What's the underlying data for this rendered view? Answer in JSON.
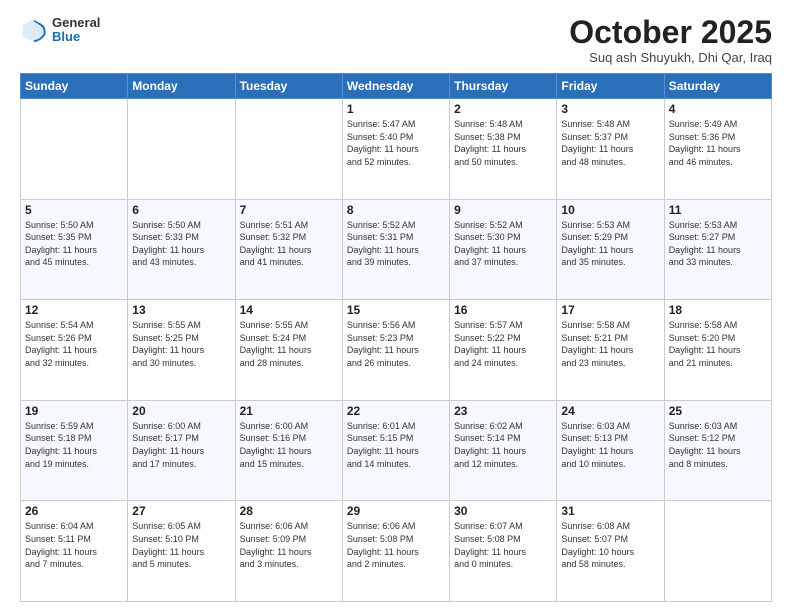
{
  "header": {
    "logo_general": "General",
    "logo_blue": "Blue",
    "month_title": "October 2025",
    "subtitle": "Suq ash Shuyukh, Dhi Qar, Iraq"
  },
  "days": [
    "Sunday",
    "Monday",
    "Tuesday",
    "Wednesday",
    "Thursday",
    "Friday",
    "Saturday"
  ],
  "weeks": [
    [
      {
        "date": "",
        "info": ""
      },
      {
        "date": "",
        "info": ""
      },
      {
        "date": "",
        "info": ""
      },
      {
        "date": "1",
        "info": "Sunrise: 5:47 AM\nSunset: 5:40 PM\nDaylight: 11 hours\nand 52 minutes."
      },
      {
        "date": "2",
        "info": "Sunrise: 5:48 AM\nSunset: 5:38 PM\nDaylight: 11 hours\nand 50 minutes."
      },
      {
        "date": "3",
        "info": "Sunrise: 5:48 AM\nSunset: 5:37 PM\nDaylight: 11 hours\nand 48 minutes."
      },
      {
        "date": "4",
        "info": "Sunrise: 5:49 AM\nSunset: 5:36 PM\nDaylight: 11 hours\nand 46 minutes."
      }
    ],
    [
      {
        "date": "5",
        "info": "Sunrise: 5:50 AM\nSunset: 5:35 PM\nDaylight: 11 hours\nand 45 minutes."
      },
      {
        "date": "6",
        "info": "Sunrise: 5:50 AM\nSunset: 5:33 PM\nDaylight: 11 hours\nand 43 minutes."
      },
      {
        "date": "7",
        "info": "Sunrise: 5:51 AM\nSunset: 5:32 PM\nDaylight: 11 hours\nand 41 minutes."
      },
      {
        "date": "8",
        "info": "Sunrise: 5:52 AM\nSunset: 5:31 PM\nDaylight: 11 hours\nand 39 minutes."
      },
      {
        "date": "9",
        "info": "Sunrise: 5:52 AM\nSunset: 5:30 PM\nDaylight: 11 hours\nand 37 minutes."
      },
      {
        "date": "10",
        "info": "Sunrise: 5:53 AM\nSunset: 5:29 PM\nDaylight: 11 hours\nand 35 minutes."
      },
      {
        "date": "11",
        "info": "Sunrise: 5:53 AM\nSunset: 5:27 PM\nDaylight: 11 hours\nand 33 minutes."
      }
    ],
    [
      {
        "date": "12",
        "info": "Sunrise: 5:54 AM\nSunset: 5:26 PM\nDaylight: 11 hours\nand 32 minutes."
      },
      {
        "date": "13",
        "info": "Sunrise: 5:55 AM\nSunset: 5:25 PM\nDaylight: 11 hours\nand 30 minutes."
      },
      {
        "date": "14",
        "info": "Sunrise: 5:55 AM\nSunset: 5:24 PM\nDaylight: 11 hours\nand 28 minutes."
      },
      {
        "date": "15",
        "info": "Sunrise: 5:56 AM\nSunset: 5:23 PM\nDaylight: 11 hours\nand 26 minutes."
      },
      {
        "date": "16",
        "info": "Sunrise: 5:57 AM\nSunset: 5:22 PM\nDaylight: 11 hours\nand 24 minutes."
      },
      {
        "date": "17",
        "info": "Sunrise: 5:58 AM\nSunset: 5:21 PM\nDaylight: 11 hours\nand 23 minutes."
      },
      {
        "date": "18",
        "info": "Sunrise: 5:58 AM\nSunset: 5:20 PM\nDaylight: 11 hours\nand 21 minutes."
      }
    ],
    [
      {
        "date": "19",
        "info": "Sunrise: 5:59 AM\nSunset: 5:18 PM\nDaylight: 11 hours\nand 19 minutes."
      },
      {
        "date": "20",
        "info": "Sunrise: 6:00 AM\nSunset: 5:17 PM\nDaylight: 11 hours\nand 17 minutes."
      },
      {
        "date": "21",
        "info": "Sunrise: 6:00 AM\nSunset: 5:16 PM\nDaylight: 11 hours\nand 15 minutes."
      },
      {
        "date": "22",
        "info": "Sunrise: 6:01 AM\nSunset: 5:15 PM\nDaylight: 11 hours\nand 14 minutes."
      },
      {
        "date": "23",
        "info": "Sunrise: 6:02 AM\nSunset: 5:14 PM\nDaylight: 11 hours\nand 12 minutes."
      },
      {
        "date": "24",
        "info": "Sunrise: 6:03 AM\nSunset: 5:13 PM\nDaylight: 11 hours\nand 10 minutes."
      },
      {
        "date": "25",
        "info": "Sunrise: 6:03 AM\nSunset: 5:12 PM\nDaylight: 11 hours\nand 8 minutes."
      }
    ],
    [
      {
        "date": "26",
        "info": "Sunrise: 6:04 AM\nSunset: 5:11 PM\nDaylight: 11 hours\nand 7 minutes."
      },
      {
        "date": "27",
        "info": "Sunrise: 6:05 AM\nSunset: 5:10 PM\nDaylight: 11 hours\nand 5 minutes."
      },
      {
        "date": "28",
        "info": "Sunrise: 6:06 AM\nSunset: 5:09 PM\nDaylight: 11 hours\nand 3 minutes."
      },
      {
        "date": "29",
        "info": "Sunrise: 6:06 AM\nSunset: 5:08 PM\nDaylight: 11 hours\nand 2 minutes."
      },
      {
        "date": "30",
        "info": "Sunrise: 6:07 AM\nSunset: 5:08 PM\nDaylight: 11 hours\nand 0 minutes."
      },
      {
        "date": "31",
        "info": "Sunrise: 6:08 AM\nSunset: 5:07 PM\nDaylight: 10 hours\nand 58 minutes."
      },
      {
        "date": "",
        "info": ""
      }
    ]
  ]
}
